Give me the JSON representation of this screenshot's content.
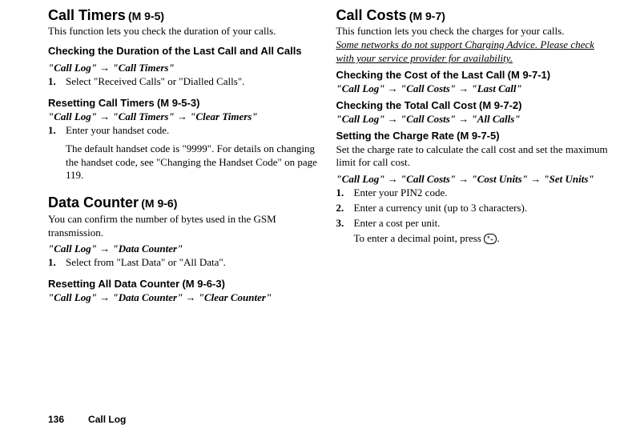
{
  "left": {
    "callTimers": {
      "title": "Call Timers",
      "code": "(M 9-5)",
      "desc": "This function lets you check the duration of your calls.",
      "checkDuration": {
        "title": "Checking the Duration of the Last Call and All Calls",
        "path1": "\"Call Log\"",
        "path2": "\"Call Timers\"",
        "step1": "Select \"Received Calls\" or \"Dialled Calls\"."
      },
      "reset": {
        "title": "Resetting Call Timers",
        "code": "(M 9-5-3)",
        "path1": "\"Call Log\"",
        "path2": "\"Call Timers\"",
        "path3": "\"Clear Timers\"",
        "step1": "Enter your handset code.",
        "step1b": "The default handset code is \"9999\". For details on changing the handset code, see \"Changing the Handset Code\" on page 119."
      }
    },
    "dataCounter": {
      "title": "Data Counter",
      "code": "(M 9-6)",
      "desc": "You can confirm the number of bytes used in the GSM transmission.",
      "path1": "\"Call Log\"",
      "path2": "\"Data Counter\"",
      "step1": "Select from \"Last Data\" or \"All Data\".",
      "reset": {
        "title": "Resetting All Data Counter",
        "code": "(M 9-6-3)",
        "path1": "\"Call Log\"",
        "path2": "\"Data Counter\"",
        "path3": "\"Clear Counter\""
      }
    }
  },
  "right": {
    "callCosts": {
      "title": "Call Costs",
      "code": "(M 9-7)",
      "desc": "This function lets you check the charges for your calls.",
      "note": "Some networks do not support Charging Advice. Please check with your service provider for availability.",
      "lastCall": {
        "title": "Checking the Cost of the Last Call",
        "code": "(M 9-7-1)",
        "path1": "\"Call Log\"",
        "path2": "\"Call Costs\"",
        "path3": "\"Last Call\""
      },
      "total": {
        "title": "Checking the Total Call Cost",
        "code": "(M 9-7-2)",
        "path1": "\"Call Log\"",
        "path2": "\"Call Costs\"",
        "path3": "\"All Calls\""
      },
      "chargeRate": {
        "title": "Setting the Charge Rate",
        "code": "(M 9-7-5)",
        "desc": "Set the charge rate to calculate the call cost and set the maximum limit for call cost.",
        "path1": "\"Call Log\"",
        "path2": "\"Call Costs\"",
        "path3": "\"Cost Units\"",
        "path4": "\"Set Units\"",
        "step1": "Enter your PIN2 code.",
        "step2": "Enter a currency unit (up to 3 characters).",
        "step3": "Enter a cost per unit.",
        "step3b_pre": "To enter a decimal point, press ",
        "step3b_key": "*₊",
        "step3b_post": "."
      }
    }
  },
  "arrow": " → ",
  "footer": {
    "page": "136",
    "section": "Call Log"
  }
}
